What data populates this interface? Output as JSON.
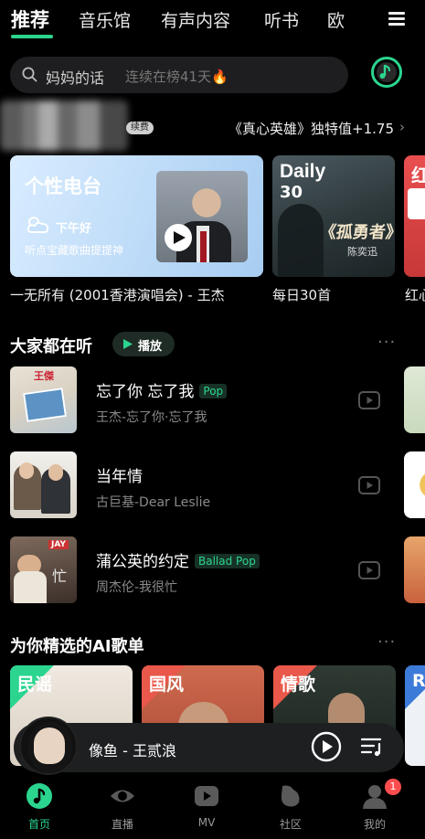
{
  "tabs": [
    {
      "label": "推荐",
      "active": true
    },
    {
      "label": "音乐馆"
    },
    {
      "label": "有声内容"
    },
    {
      "label": "听书"
    },
    {
      "label": "欧"
    }
  ],
  "search": {
    "keyword": "妈妈的话",
    "subtitle": "连续在榜41天🔥"
  },
  "promo": {
    "badge": "续费",
    "text": "《真心英雄》独特值+1.75",
    "arrow": "›"
  },
  "cards": {
    "radio": {
      "title": "个性电台",
      "greeting": "下午好",
      "desc": "听点宝藏歌曲提提神",
      "caption": "一无所有 (2001香港演唱会) - 王杰"
    },
    "daily": {
      "word": "Daily",
      "num": "30",
      "art_title": "《孤勇者》",
      "art_artist": "陈奕迅",
      "caption": "每日30首"
    },
    "red": {
      "label": "红",
      "caption": "红心"
    }
  },
  "section_listen": {
    "title": "大家都在听",
    "play_label": "播放",
    "more": "···"
  },
  "songs": [
    {
      "title": "忘了你 忘了我",
      "tag": "Pop",
      "sub": "王杰-忘了你·忘了我",
      "cover_text": "王傑"
    },
    {
      "title": "当年情",
      "tag": "",
      "sub": "古巨基-Dear Leslie",
      "cover_text": ""
    },
    {
      "title": "蒲公英的约定",
      "tag": "Ballad Pop",
      "sub": "周杰伦-我很忙",
      "cover_text": "JAY"
    }
  ],
  "section_ai": {
    "title": "为你精选的AI歌单",
    "more": "···"
  },
  "playlists": [
    {
      "label": "民谣",
      "color": "#2bd58f"
    },
    {
      "label": "国风",
      "color": "#e9584a"
    },
    {
      "label": "情歌",
      "color": "#e9584a"
    },
    {
      "label": "R",
      "color": "#3d7bd8"
    }
  ],
  "player": {
    "now_playing": "像鱼 - 王贰浪"
  },
  "nav": [
    {
      "label": "首页",
      "active": true,
      "icon": "home-note-icon"
    },
    {
      "label": "直播",
      "icon": "eye-icon"
    },
    {
      "label": "MV",
      "icon": "video-play-icon"
    },
    {
      "label": "社区",
      "icon": "community-icon"
    },
    {
      "label": "我的",
      "icon": "profile-icon",
      "badge": "1"
    }
  ],
  "colors": {
    "accent": "#2bd58f",
    "background": "#000000"
  }
}
